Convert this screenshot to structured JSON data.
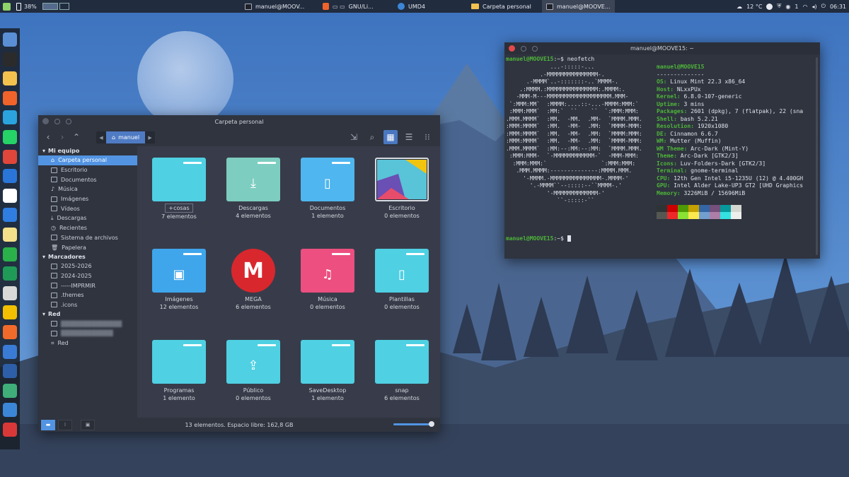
{
  "panel": {
    "battery": "38%",
    "tasks": [
      {
        "label": "manuel@MOOV...",
        "icon": "terminal-icon"
      },
      {
        "label": "GNU/Li...",
        "icon": "brave-icon"
      },
      {
        "label": "UMD4",
        "icon": "globe-icon"
      },
      {
        "label": "Carpeta personal",
        "icon": "folder-icon"
      },
      {
        "label": "manuel@MOOVE...",
        "icon": "terminal-icon"
      }
    ],
    "temperature": "12 °C",
    "notifications": "1",
    "clock": "06:31"
  },
  "file_manager": {
    "title": "Carpeta personal",
    "breadcrumb": "manuel",
    "sidebar": {
      "sections": [
        {
          "title": "Mi equipo",
          "items": [
            "Carpeta personal",
            "Escritorio",
            "Documentos",
            "Música",
            "Imágenes",
            "Vídeos",
            "Descargas",
            "Recientes",
            "Sistema de archivos",
            "Papelera"
          ]
        },
        {
          "title": "Marcadores",
          "items": [
            "2025-2026",
            "2024-2025",
            "-----IMPRMIR",
            ".themes",
            ".icons"
          ]
        },
        {
          "title": "Red",
          "items": [
            "Red"
          ]
        }
      ]
    },
    "folders": [
      {
        "name": "+cosas",
        "count": "7 elementos",
        "color": "#4fd0e3",
        "symbol": ""
      },
      {
        "name": "Descargas",
        "count": "4 elementos",
        "color": "#7dcdc0",
        "symbol": "⤓"
      },
      {
        "name": "Documentos",
        "count": "1  elemento",
        "color": "#4fb6ef",
        "symbol": "▯"
      },
      {
        "name": "Escritorio",
        "count": "0 elementos",
        "color": "#2b2f3a",
        "symbol": ""
      },
      {
        "name": "Imágenes",
        "count": "12 elementos",
        "color": "#3fa6ec",
        "symbol": "▣"
      },
      {
        "name": "MEGA",
        "count": "6 elementos",
        "color": "#d9272e",
        "symbol": "M"
      },
      {
        "name": "Música",
        "count": "0 elementos",
        "color": "#ec4f80",
        "symbol": "♫"
      },
      {
        "name": "Plantillas",
        "count": "0 elementos",
        "color": "#4fd0e3",
        "symbol": "▯"
      },
      {
        "name": "Programas",
        "count": "1  elemento",
        "color": "#4fd0e3",
        "symbol": ""
      },
      {
        "name": "Público",
        "count": "0 elementos",
        "color": "#4fd0e3",
        "symbol": "⇪"
      },
      {
        "name": "SaveDesktop",
        "count": "1  elemento",
        "color": "#4fd0e3",
        "symbol": ""
      },
      {
        "name": "snap",
        "count": "6 elementos",
        "color": "#4fd0e3",
        "symbol": ""
      }
    ],
    "status": "13 elementos. Espacio libre: 162,8 GB"
  },
  "terminal": {
    "title": "manuel@MOOVE15: ~",
    "prompt_user": "manuel@MOOVE15",
    "prompt_path": ":~$ ",
    "command": "neofetch",
    "header": "manuel@MOOVE15",
    "separator": "--------------",
    "ascii_art": [
      "             ...-:::::-...",
      "          .-MMMMMMMMMMMMMMM-.",
      "      .-MMMM`..-:::::::-..`MMMM-.",
      "    .:MMMM.:MMMMMMMMMMMMMMM:.MMMM:.",
      "   -MMM-M---MMMMMMMMMMMMMMMMMMM.MMM-",
      " `:MMM:MM`  :MMMM:....::-...-MMMM:MMM:`",
      " :MMM:MMM`  :MM:`  ``    ``  `:MMM:MMM:",
      ".MMM.MMMM`  :MM.  -MM.  .MM-  `MMMM.MMM.",
      ":MMM:MMMM`  :MM.  -MM-  .MM:  `MMMM-MMM:",
      ":MMM:MMMM`  :MM.  -MM-  .MM:  `MMMM:MMM:",
      ":MMM:MMMM`  :MM.  -MM-  .MM:  `MMMM-MMM:",
      ".MMM.MMMM`  :MM:--:MM:--:MM:  `MMMM.MMM.",
      " :MMM:MMM-  `-MMMMMMMMMMMM-`  -MMM-MMM:",
      "  :MMM:MMM:`                `:MMM:MMM:",
      "   .MMM.MMMM:--------------:MMMM.MMM.",
      "     '-MMMM.-MMMMMMMMMMMMMMM-.MMMM-'",
      "       '.-MMMM``--:::::--``MMMM-.'",
      "            '-MMMMMMMMMMMMM-'",
      "               ``-:::::-``"
    ],
    "info": [
      {
        "k": "OS",
        "v": "Linux Mint 22.3 x86_64"
      },
      {
        "k": "Host",
        "v": "NLxxPUx"
      },
      {
        "k": "Kernel",
        "v": "6.8.0-107-generic"
      },
      {
        "k": "Uptime",
        "v": "3 mins"
      },
      {
        "k": "Packages",
        "v": "2601 (dpkg), 7 (flatpak), 22 (sna"
      },
      {
        "k": "Shell",
        "v": "bash 5.2.21"
      },
      {
        "k": "Resolution",
        "v": "1920x1080"
      },
      {
        "k": "DE",
        "v": "Cinnamon 6.6.7"
      },
      {
        "k": "WM",
        "v": "Mutter (Muffin)"
      },
      {
        "k": "WM Theme",
        "v": "Arc-Dark (Mint-Y)"
      },
      {
        "k": "Theme",
        "v": "Arc-Dark [GTK2/3]"
      },
      {
        "k": "Icons",
        "v": "Luv-Folders-Dark [GTK2/3]"
      },
      {
        "k": "Terminal",
        "v": "gnome-terminal"
      },
      {
        "k": "CPU",
        "v": "12th Gen Intel i5-1235U (12) @ 4.400GH"
      },
      {
        "k": "GPU",
        "v": "Intel Alder Lake-UP3 GT2 [UHD Graphics"
      },
      {
        "k": "Memory",
        "v": "3226MiB / 15696MiB"
      }
    ],
    "palette": [
      "#2e3436",
      "#cc0000",
      "#4e9a06",
      "#c4a000",
      "#3465a4",
      "#75507b",
      "#06989a",
      "#d3d7cf",
      "#555753",
      "#ef2929",
      "#8ae234",
      "#fce94f",
      "#729fcf",
      "#ad7fa8",
      "#34e2e2",
      "#eeeeec"
    ]
  },
  "dock": {
    "apps": [
      {
        "name": "screen-icon",
        "color": "#5a8fd6"
      },
      {
        "name": "terminal-icon",
        "color": "#2b2b2b"
      },
      {
        "name": "files-icon",
        "color": "#f2c14e"
      },
      {
        "name": "brave-icon",
        "color": "#f0632a"
      },
      {
        "name": "telegram-icon",
        "color": "#2aa3df"
      },
      {
        "name": "whatsapp-icon",
        "color": "#25d366"
      },
      {
        "name": "chrome-icon",
        "color": "#e0463a"
      },
      {
        "name": "thunderbird-icon",
        "color": "#2a75d8"
      },
      {
        "name": "calendar-icon",
        "color": "#ffffff"
      },
      {
        "name": "writer-icon",
        "color": "#2f7de1"
      },
      {
        "name": "notes-icon",
        "color": "#f4e08a"
      },
      {
        "name": "calc-icon",
        "color": "#2bb14a"
      },
      {
        "name": "book-icon",
        "color": "#1f9b57"
      },
      {
        "name": "mail-icon",
        "color": "#d8d8d8"
      },
      {
        "name": "yellow-app-icon",
        "color": "#f2c000"
      },
      {
        "name": "appstore-icon",
        "color": "#f06b2a"
      },
      {
        "name": "disk-icon",
        "color": "#3a7bd5"
      },
      {
        "name": "shield-icon",
        "color": "#2d5fa8"
      },
      {
        "name": "image-viewer-icon",
        "color": "#3fae79"
      },
      {
        "name": "globe-icon",
        "color": "#3c86d8"
      },
      {
        "name": "firewall-icon",
        "color": "#d93838"
      }
    ]
  }
}
